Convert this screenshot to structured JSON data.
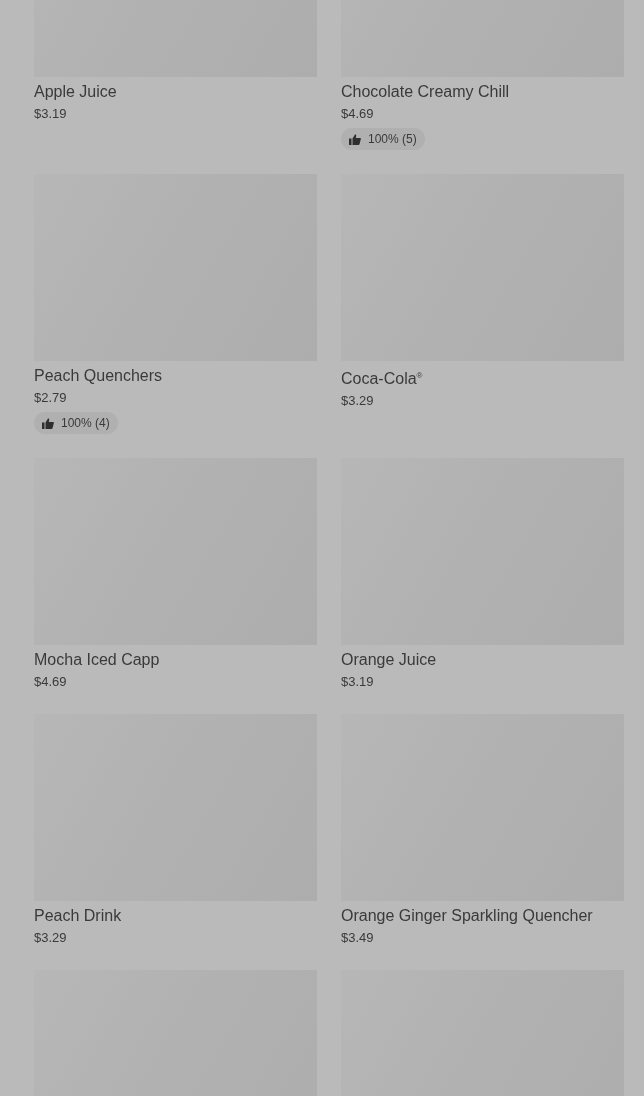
{
  "products": [
    {
      "kind": "product",
      "name": "Apple Juice",
      "price": "$3.19"
    },
    {
      "kind": "product",
      "name": "Chocolate Creamy Chill",
      "price": "$4.69",
      "rating": "100% (5)"
    },
    {
      "kind": "product",
      "name": "Peach Quenchers",
      "price": "$2.79",
      "rating": "100% (4)"
    },
    {
      "kind": "product",
      "name": "Coca-Cola$^{®}$",
      "price": "$3.29"
    },
    {
      "kind": "product",
      "name": "Mocha Iced Capp",
      "price": "$4.69"
    },
    {
      "kind": "product",
      "name": "Orange Juice",
      "price": "$3.19"
    },
    {
      "kind": "product",
      "name": "Peach Drink",
      "price": "$3.29"
    },
    {
      "kind": "product",
      "name": "Orange Ginger Sparkling Quencher",
      "price": "$3.49"
    },
    {
      "kind": "image_only"
    },
    {
      "kind": "image_only"
    }
  ]
}
